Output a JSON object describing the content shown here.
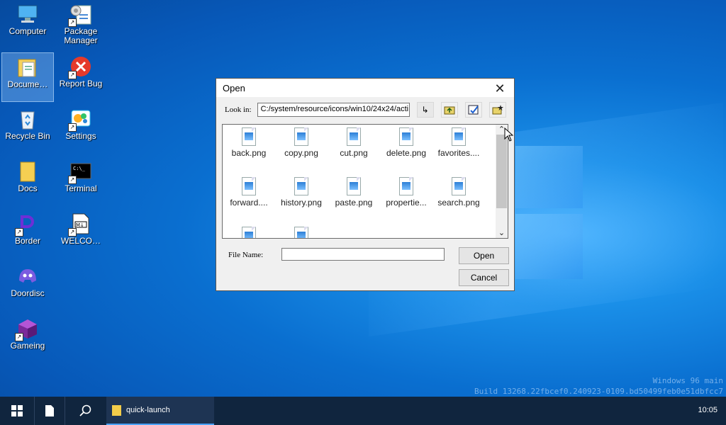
{
  "desktop": {
    "icons": [
      {
        "label": "Computer",
        "icon": "computer-icon"
      },
      {
        "label": "Package Manager",
        "icon": "package-manager-icon"
      },
      {
        "label": "Docume…",
        "icon": "folder-documents-icon"
      },
      {
        "label": "Report Bug",
        "icon": "report-bug-icon"
      },
      {
        "label": "Recycle Bin",
        "icon": "recycle-bin-icon"
      },
      {
        "label": "Settings",
        "icon": "settings-icon"
      },
      {
        "label": "Docs",
        "icon": "folder-icon"
      },
      {
        "label": "Terminal",
        "icon": "terminal-icon"
      },
      {
        "label": "Border",
        "icon": "border-app-icon"
      },
      {
        "label": "WELCO…",
        "icon": "markdown-file-icon"
      },
      {
        "label": "Doordisc",
        "icon": "discord-icon"
      },
      {
        "label": "Gameing",
        "icon": "cube-game-icon"
      }
    ]
  },
  "dialog": {
    "title": "Open",
    "look_in_label": "Look in:",
    "path": "C:/system/resource/icons/win10/24x24/acti",
    "files": [
      "back.png",
      "copy.png",
      "cut.png",
      "delete.png",
      "favorites....",
      "forward....",
      "history.png",
      "paste.png",
      "propertie...",
      "search.png",
      "",
      ""
    ],
    "file_name_label": "File Name:",
    "file_name_value": "",
    "open_label": "Open",
    "cancel_label": "Cancel"
  },
  "watermark": {
    "line1": "Windows 96 main",
    "line2": "Build 13268.22fbcef0.240923-0109.bd50499feb0e51dbfcc7"
  },
  "taskbar": {
    "task_label": "quick-launch",
    "clock": "10:05"
  },
  "colors": {
    "accent": "#4aa3ff",
    "taskbar": "#10253e",
    "desktop": "#0a6fd0"
  }
}
